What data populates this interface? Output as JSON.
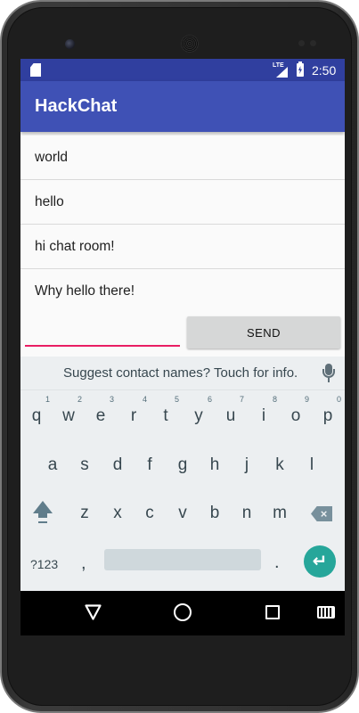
{
  "status_bar": {
    "network": "LTE",
    "time": "2:50",
    "icons": [
      "sd-card-icon",
      "signal-icon",
      "battery-charging-icon"
    ]
  },
  "app_bar": {
    "title": "HackChat"
  },
  "messages": [
    {
      "text": "world"
    },
    {
      "text": "hello"
    },
    {
      "text": "hi chat room!"
    },
    {
      "text": "Why hello there!"
    }
  ],
  "compose": {
    "input_value": "",
    "send_label": "SEND"
  },
  "keyboard": {
    "suggestion": "Suggest contact names? Touch for info.",
    "row1": [
      {
        "key": "q",
        "hint": "1"
      },
      {
        "key": "w",
        "hint": "2"
      },
      {
        "key": "e",
        "hint": "3"
      },
      {
        "key": "r",
        "hint": "4"
      },
      {
        "key": "t",
        "hint": "5"
      },
      {
        "key": "y",
        "hint": "6"
      },
      {
        "key": "u",
        "hint": "7"
      },
      {
        "key": "i",
        "hint": "8"
      },
      {
        "key": "o",
        "hint": "9"
      },
      {
        "key": "p",
        "hint": "0"
      }
    ],
    "row2": [
      "a",
      "s",
      "d",
      "f",
      "g",
      "h",
      "j",
      "k",
      "l"
    ],
    "row3": [
      "z",
      "x",
      "c",
      "v",
      "b",
      "n",
      "m"
    ],
    "symbols_label": "?123",
    "comma": ",",
    "period": "."
  },
  "colors": {
    "status_bar": "#303f9f",
    "app_bar": "#3f51b5",
    "input_underline": "#e91e63",
    "enter_key": "#26a69a"
  },
  "nav_bar": {
    "icons": [
      "back-icon",
      "home-icon",
      "recents-icon",
      "keyboard-switch-icon"
    ]
  }
}
